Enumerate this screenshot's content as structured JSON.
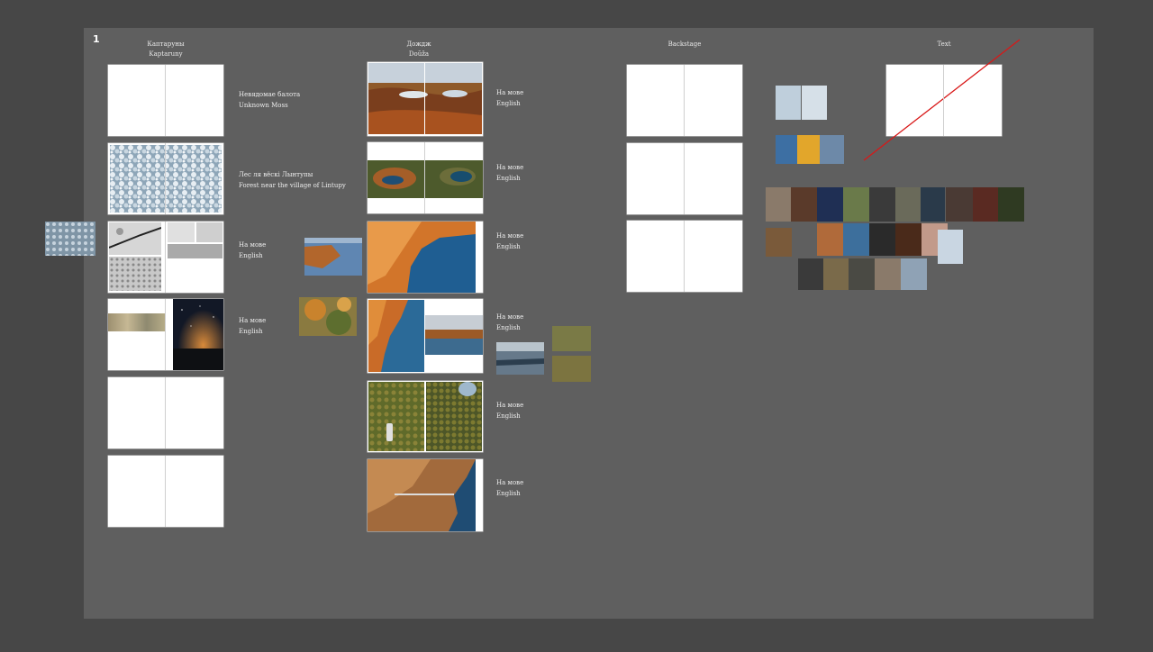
{
  "board": {
    "number": "1"
  },
  "columns": [
    {
      "title_1": "Каптаруны",
      "title_2": "Kaptaruny"
    },
    {
      "title_1": "Дождж",
      "title_2": "Doŭža"
    },
    {
      "title_1": "Backstage"
    },
    {
      "title_1": "Text"
    }
  ],
  "captions": {
    "c1_1": {
      "line1": "Невядомае балота",
      "line2": "Unknown Moss"
    },
    "c1_2": {
      "line1": "Лес ля вёскі Лынтупы",
      "line2": "Forest near the village of Lintupy"
    },
    "c1_3": {
      "line1": "На мове",
      "line2": "English"
    },
    "c1_4": {
      "line1": "На мове",
      "line2": "English"
    },
    "c2_1": {
      "line1": "На мове",
      "line2": "English"
    },
    "c2_2": {
      "line1": "На мове",
      "line2": "English"
    },
    "c2_3": {
      "line1": "На мове",
      "line2": "English"
    },
    "c2_4": {
      "line1": "На мове",
      "line2": "English"
    },
    "c2_5": {
      "line1": "На мове",
      "line2": "English"
    },
    "c2_6": {
      "line1": "На мове",
      "line2": "English"
    }
  },
  "colors": {
    "canvas": "#474747",
    "board": "#5f5f5f",
    "page": "#ffffff",
    "strike": "#d81818"
  }
}
